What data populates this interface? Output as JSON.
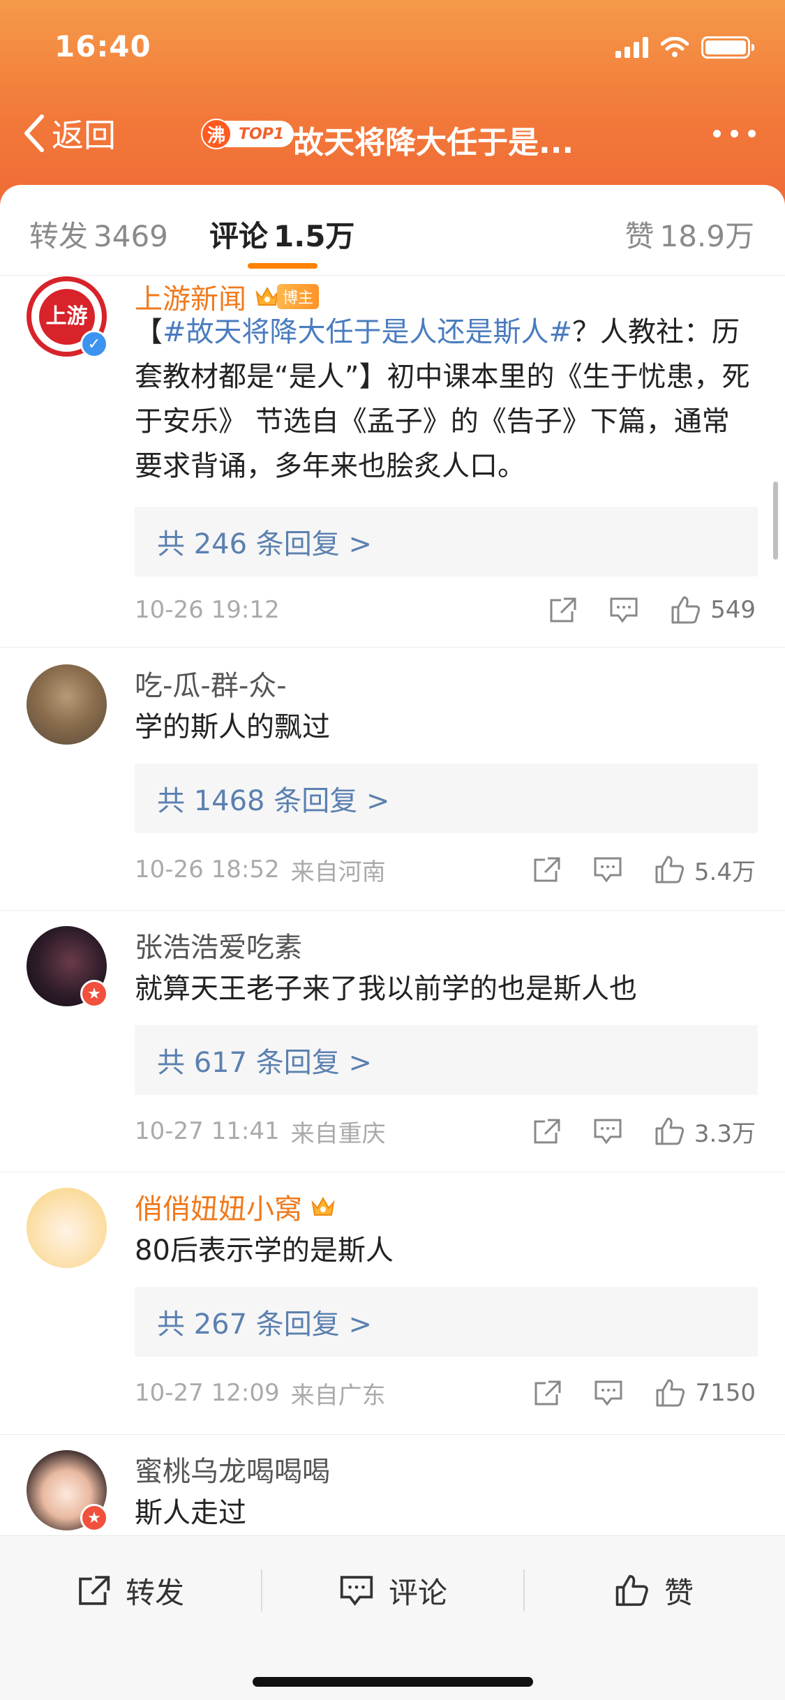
{
  "status_bar": {
    "time": "16:40"
  },
  "nav": {
    "back_label": "返回",
    "fire_badge": "沸",
    "top_badge": "TOP1",
    "title": "故天将降大任于是..."
  },
  "tabs": {
    "repost_label": "转发",
    "repost_count": "3469",
    "comments_label": "评论",
    "comments_count": "1.5万",
    "likes_label": "赞",
    "likes_count": "18.9万"
  },
  "comments": [
    {
      "username": "上游新闻",
      "avatar_text": "上游",
      "badge": "博主",
      "hashtag": "#故天将降大任于是人还是斯人#",
      "text": "？人教社：历套教材都是“是人”】初中课本里的《生于忧患，死于安乐》 节选自《孟子》的《告子》下篇，通常要求背诵，多年来也脍炙人口。",
      "text_prefix": "【",
      "replies": "共 246 条回复 >",
      "time": "10-26 19:12",
      "location": "",
      "likes": "549"
    },
    {
      "username": "吃-瓜-群-众-",
      "text": "学的斯人的飘过",
      "replies": "共 1468 条回复 >",
      "time": "10-26 18:52",
      "location": "来自河南",
      "likes": "5.4万"
    },
    {
      "username": "张浩浩爱吃素",
      "text": "就算天王老子来了我以前学的也是斯人也",
      "replies": "共 617 条回复 >",
      "time": "10-27 11:41",
      "location": "来自重庆",
      "likes": "3.3万"
    },
    {
      "username": "俏俏妞妞小窝",
      "text": "80后表示学的是斯人",
      "replies": "共 267 条回复 >",
      "time": "10-27 12:09",
      "location": "来自广东",
      "likes": "7150"
    },
    {
      "username": "蜜桃乌龙喝喝喝",
      "text": "斯人走过"
    }
  ],
  "bottom_bar": {
    "repost_label": "转发",
    "comment_label": "评论",
    "like_label": "赞"
  },
  "colors": {
    "header_orange": "#f2793a",
    "accent": "#ff8200",
    "link_blue": "#5b80b0",
    "username_orange": "#f07a1c"
  },
  "icons": [
    "back-chevron-icon",
    "more-icon",
    "crown-icon",
    "verified-icon",
    "share-icon",
    "comment-icon",
    "like-icon"
  ]
}
